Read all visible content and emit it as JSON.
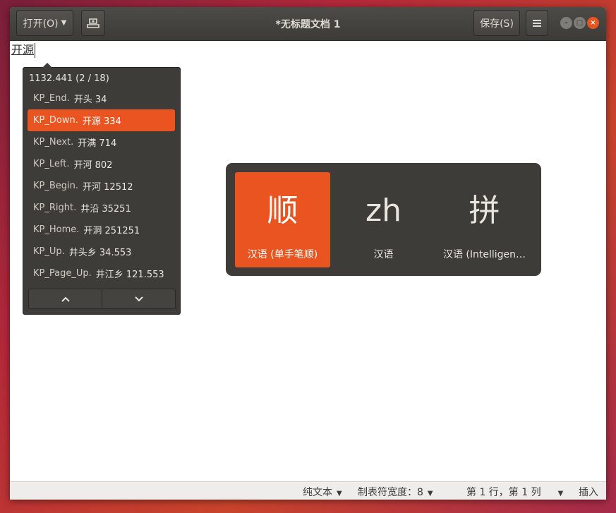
{
  "window": {
    "title": "*无标题文档 1",
    "open_label": "打开(O)",
    "save_label": "保存(S)"
  },
  "editor": {
    "text": "开源"
  },
  "candidates": {
    "header": "1132.441 (2 / 18)",
    "items": [
      {
        "key": "KP_End.",
        "text": "开头 34"
      },
      {
        "key": "KP_Down.",
        "text": "开源 334"
      },
      {
        "key": "KP_Next.",
        "text": "开满 714"
      },
      {
        "key": "KP_Left.",
        "text": "开河 802"
      },
      {
        "key": "KP_Begin.",
        "text": "开河 12512"
      },
      {
        "key": "KP_Right.",
        "text": "井沿 35251"
      },
      {
        "key": "KP_Home.",
        "text": "开洞 251251"
      },
      {
        "key": "KP_Up.",
        "text": "井头乡 34.553"
      },
      {
        "key": "KP_Page_Up.",
        "text": "井江乡 121.553"
      }
    ],
    "selected_index": 1
  },
  "input_methods": [
    {
      "symbol": "顺",
      "label": "汉语 (单手笔顺)",
      "active": true
    },
    {
      "symbol": "zh",
      "label": "汉语",
      "active": false
    },
    {
      "symbol": "拼",
      "label": "汉语 (Intelligen…",
      "active": false
    }
  ],
  "statusbar": {
    "language": "纯文本",
    "tab_width": "制表符宽度：8",
    "position": "第 1 行，第 1 列",
    "mode": "插入"
  },
  "colors": {
    "accent": "#e95420",
    "headerbar": "#3d3b38",
    "popup_bg": "#3d3c38"
  }
}
